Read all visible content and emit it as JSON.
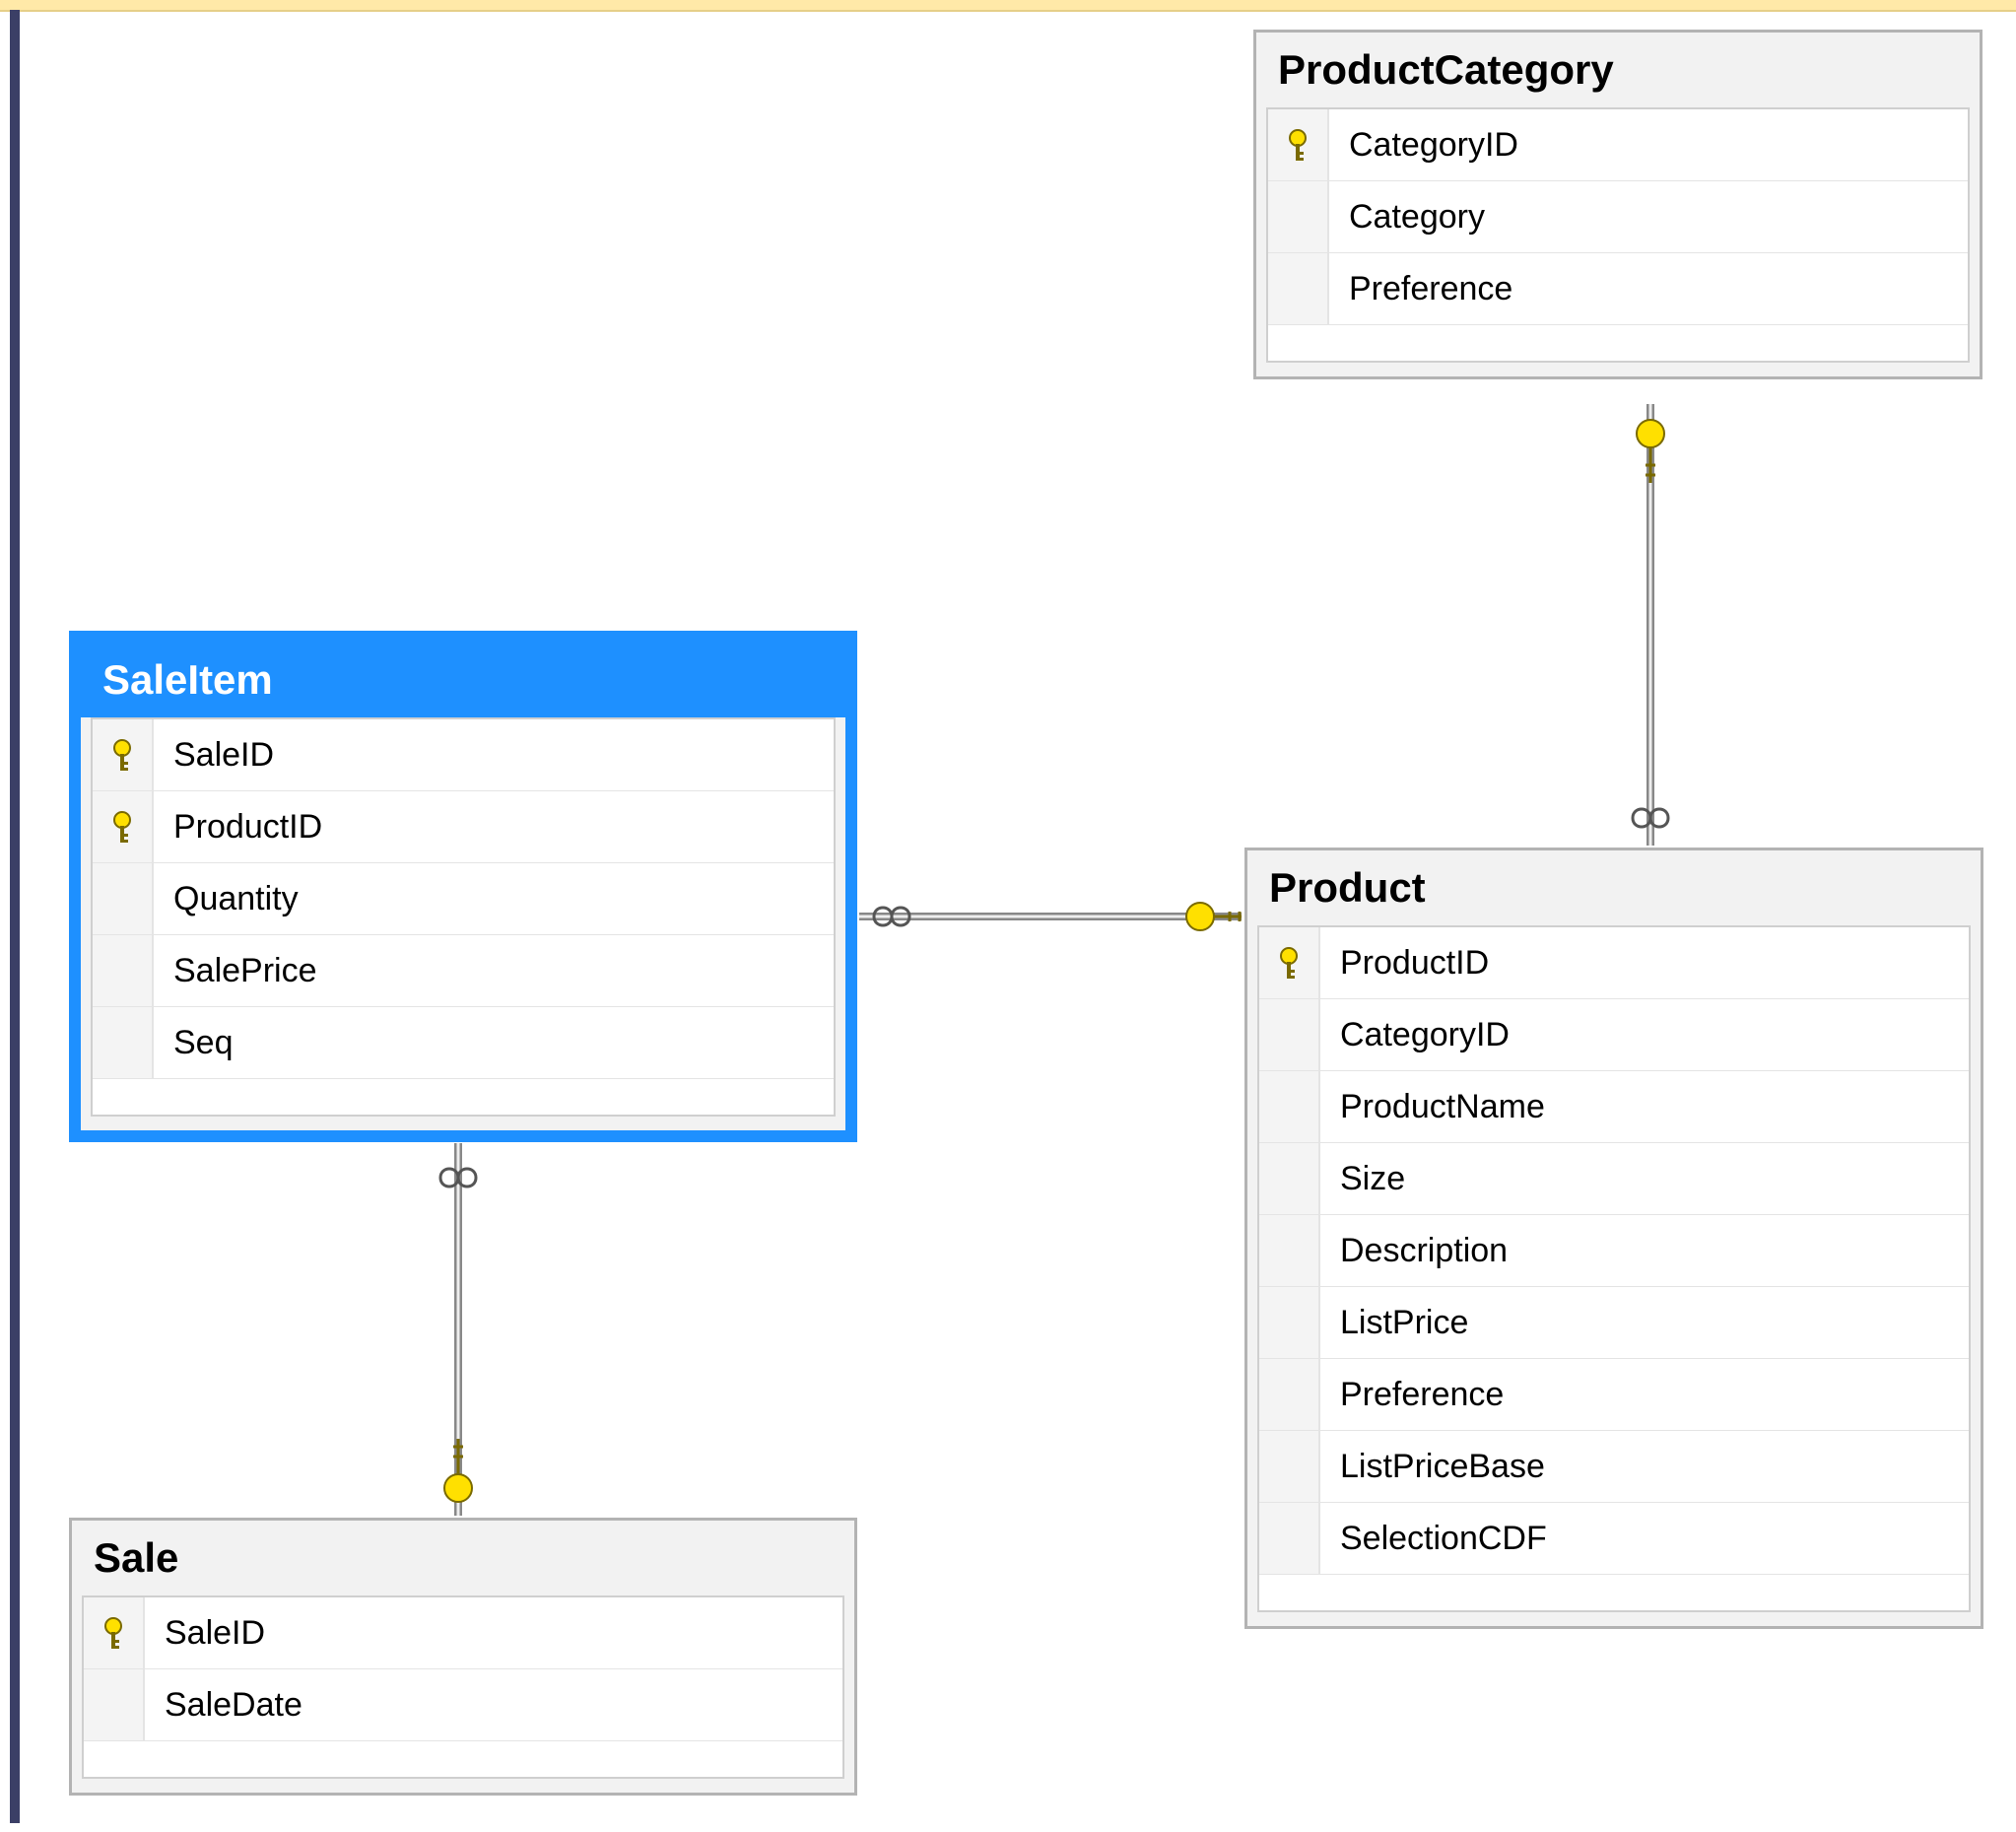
{
  "tables": {
    "productCategory": {
      "title": "ProductCategory",
      "columns": [
        {
          "name": "CategoryID",
          "pk": true
        },
        {
          "name": "Category",
          "pk": false
        },
        {
          "name": "Preference",
          "pk": false
        }
      ]
    },
    "saleItem": {
      "title": "SaleItem",
      "selected": true,
      "columns": [
        {
          "name": "SaleID",
          "pk": true
        },
        {
          "name": "ProductID",
          "pk": true
        },
        {
          "name": "Quantity",
          "pk": false
        },
        {
          "name": "SalePrice",
          "pk": false
        },
        {
          "name": "Seq",
          "pk": false
        }
      ]
    },
    "product": {
      "title": "Product",
      "columns": [
        {
          "name": "ProductID",
          "pk": true
        },
        {
          "name": "CategoryID",
          "pk": false
        },
        {
          "name": "ProductName",
          "pk": false
        },
        {
          "name": "Size",
          "pk": false
        },
        {
          "name": "Description",
          "pk": false
        },
        {
          "name": "ListPrice",
          "pk": false
        },
        {
          "name": "Preference",
          "pk": false
        },
        {
          "name": "ListPriceBase",
          "pk": false
        },
        {
          "name": "SelectionCDF",
          "pk": false
        }
      ]
    },
    "sale": {
      "title": "Sale",
      "columns": [
        {
          "name": "SaleID",
          "pk": true
        },
        {
          "name": "SaleDate",
          "pk": false
        }
      ]
    }
  },
  "relationships": [
    {
      "from": "ProductCategory.CategoryID",
      "to": "Product.CategoryID",
      "type": "one-to-many"
    },
    {
      "from": "Product.ProductID",
      "to": "SaleItem.ProductID",
      "type": "one-to-many"
    },
    {
      "from": "Sale.SaleID",
      "to": "SaleItem.SaleID",
      "type": "one-to-many"
    }
  ]
}
